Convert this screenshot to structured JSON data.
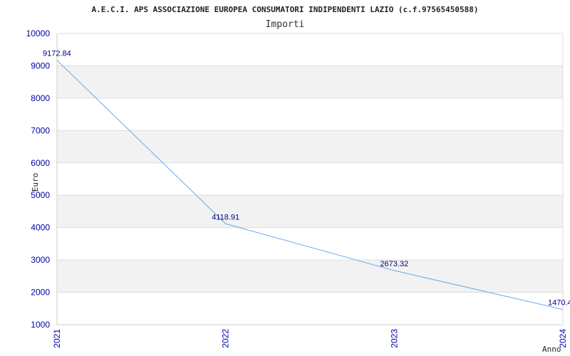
{
  "chart_data": {
    "type": "line",
    "title": "A.E.C.I. APS ASSOCIAZIONE EUROPEA CONSUMATORI INDIPENDENTI LAZIO (c.f.97565450588)",
    "subtitle": "Importi",
    "xlabel": "Anno",
    "ylabel": "Euro",
    "categories": [
      "2021",
      "2022",
      "2023",
      "2024"
    ],
    "series": [
      {
        "values": [
          9172.84,
          4118.91,
          2673.32,
          1470.4
        ],
        "labels": [
          "9172.84",
          "4118.91",
          "2673.32",
          "1470.4"
        ]
      }
    ],
    "ylim": [
      1000,
      10000
    ],
    "yticks": [
      1000,
      2000,
      3000,
      4000,
      5000,
      6000,
      7000,
      8000,
      9000,
      10000
    ],
    "grid": true,
    "line_color": "#66aaee",
    "band_color": "#f2f2f2",
    "tick_color": "#0000aa"
  }
}
